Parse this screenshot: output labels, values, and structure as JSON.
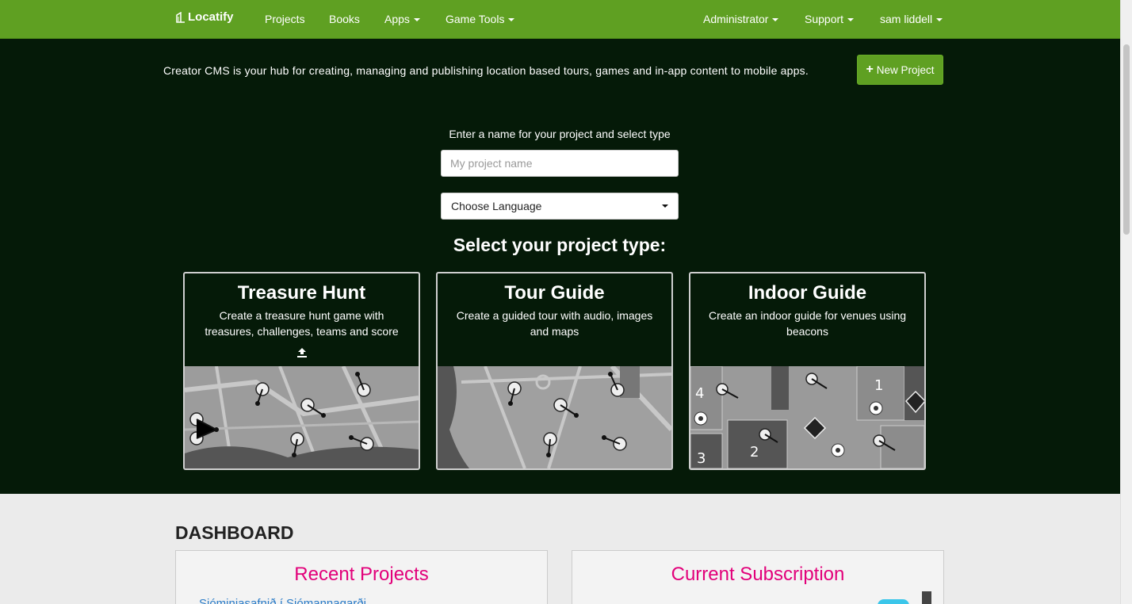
{
  "nav": {
    "brand": "Locatify",
    "left_items": [
      "Projects",
      "Books",
      "Apps",
      "Game Tools"
    ],
    "right_items": [
      "Administrator",
      "Support",
      "sam liddell"
    ],
    "color": "#5fa022"
  },
  "hero": {
    "intro": "Creator CMS is your hub for creating, managing and publishing location based tours, games and in-app content to mobile apps.",
    "new_project_label": "New Project",
    "prompt": "Enter a name for your project and select type",
    "name_placeholder": "My project name",
    "language_selected": "Choose Language",
    "select_title": "Select your project type:",
    "background": "#051a08"
  },
  "project_types": [
    {
      "title": "Treasure Hunt",
      "description": "Create a treasure hunt game with treasures, challenges, teams and score"
    },
    {
      "title": "Tour Guide",
      "description": "Create a guided tour with audio, images and maps"
    },
    {
      "title": "Indoor Guide",
      "description": "Create an indoor guide for venues using beacons"
    }
  ],
  "dashboard": {
    "title": "DASHBOARD",
    "recent_projects_title": "Recent Projects",
    "recent_project_link": "Sjóminjasafnið í Sjómannagarði",
    "subscription_title": "Current Subscription",
    "accent": "#e2007a"
  }
}
